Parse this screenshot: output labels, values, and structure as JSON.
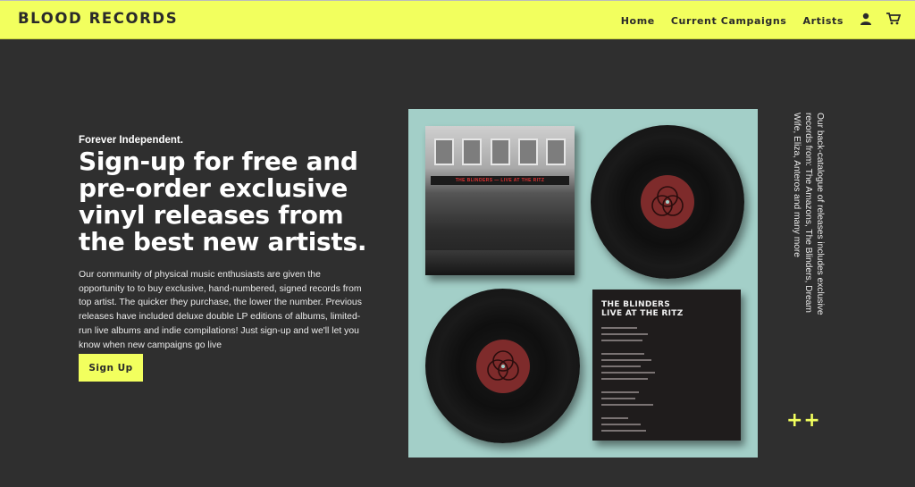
{
  "header": {
    "brand": "BLOOD RECORDS",
    "nav": [
      "Home",
      "Current Campaigns",
      "Artists"
    ],
    "icons": [
      "account-icon",
      "cart-icon"
    ]
  },
  "hero": {
    "eyebrow": "Forever Independent.",
    "headline": "Sign-up for free and pre-order exclusive vinyl releases from the best new artists.",
    "body": "Our community of physical music enthusiasts are given the opportunity to to buy exclusive, hand-numbered, signed records from top artist. The quicker they purchase, the lower the number. Previous releases have included deluxe double LP editions of albums, limited-run live albums and indie compilations! Just sign-up and we'll let you know when new campaigns go live",
    "cta": "Sign Up"
  },
  "artwork": {
    "front_marquee": "THE BLINDERS — LIVE AT THE RITZ",
    "back_title": "THE BLINDERS\nLIVE AT THE RITZ"
  },
  "side_note": "Our back-catalogue of releases includes exclusive records from: The Amazons, The Blinders, Dream Wife, Eliza, Anteros and many more",
  "decoration": {
    "plus": "++"
  },
  "colors": {
    "accent": "#f2ff5e",
    "background": "#2f2f2f",
    "art_bg": "#a3cfc8"
  }
}
